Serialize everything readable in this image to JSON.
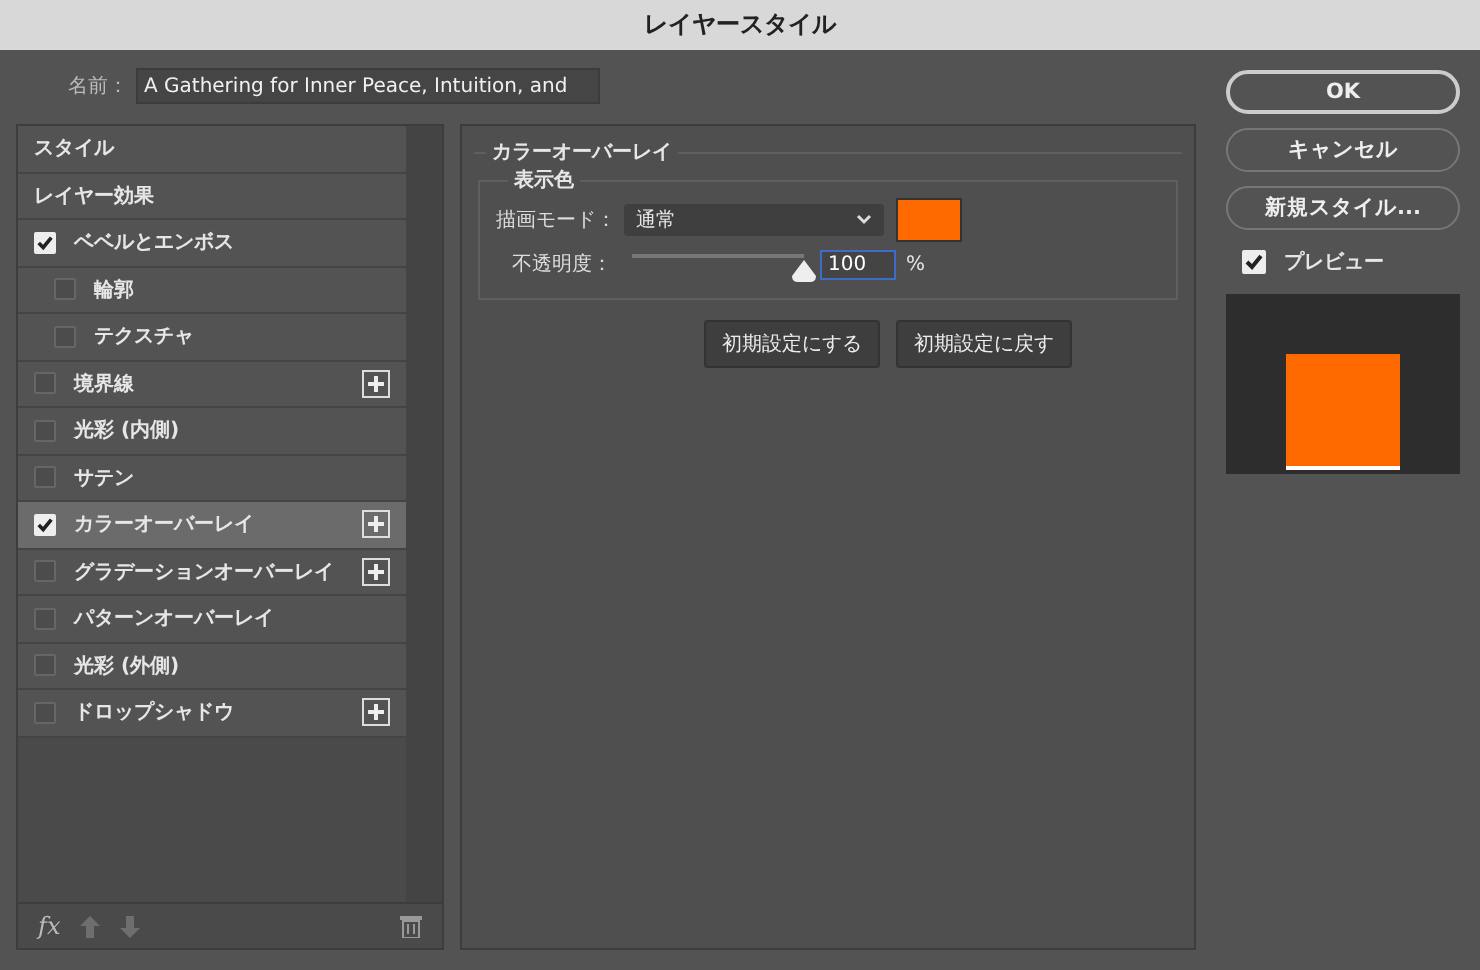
{
  "window": {
    "title": "レイヤースタイル"
  },
  "name_field": {
    "label": "名前：",
    "value": "A Gathering for Inner Peace, Intuition, and"
  },
  "styles": [
    {
      "kind": "header",
      "label": "スタイル",
      "selected": false
    },
    {
      "kind": "header",
      "label": "レイヤー効果",
      "selected": false
    },
    {
      "kind": "effect",
      "label": "ベベルとエンボス",
      "checked": true,
      "selected": false,
      "addable": false,
      "children": [
        {
          "kind": "effect",
          "label": "輪郭",
          "checked": false,
          "selected": false,
          "addable": false
        },
        {
          "kind": "effect",
          "label": "テクスチャ",
          "checked": false,
          "selected": false,
          "addable": false
        }
      ]
    },
    {
      "kind": "effect",
      "label": "境界線",
      "checked": false,
      "selected": false,
      "addable": true
    },
    {
      "kind": "effect",
      "label": "光彩 (内側)",
      "checked": false,
      "selected": false,
      "addable": false
    },
    {
      "kind": "effect",
      "label": "サテン",
      "checked": false,
      "selected": false,
      "addable": false
    },
    {
      "kind": "effect",
      "label": "カラーオーバーレイ",
      "checked": true,
      "selected": true,
      "addable": true
    },
    {
      "kind": "effect",
      "label": "グラデーションオーバーレイ",
      "checked": false,
      "selected": false,
      "addable": true
    },
    {
      "kind": "effect",
      "label": "パターンオーバーレイ",
      "checked": false,
      "selected": false,
      "addable": false
    },
    {
      "kind": "effect",
      "label": "光彩 (外側)",
      "checked": false,
      "selected": false,
      "addable": false
    },
    {
      "kind": "effect",
      "label": "ドロップシャドウ",
      "checked": false,
      "selected": false,
      "addable": true
    }
  ],
  "list_toolbar": {
    "fx": "fx"
  },
  "overlay": {
    "title": "カラーオーバーレイ",
    "group": "表示色",
    "blend_label": "描画モード：",
    "blend_value": "通常",
    "color": "#ff6a00",
    "opacity_label": "不透明度：",
    "opacity": {
      "level": 1,
      "value": "100",
      "unit": "%"
    },
    "buttons": [
      "初期設定にする",
      "初期設定に戻す"
    ]
  },
  "actions": [
    "OK",
    "キャンセル",
    "新規スタイル..."
  ],
  "preview": {
    "label": "プレビュー",
    "checked": true
  }
}
